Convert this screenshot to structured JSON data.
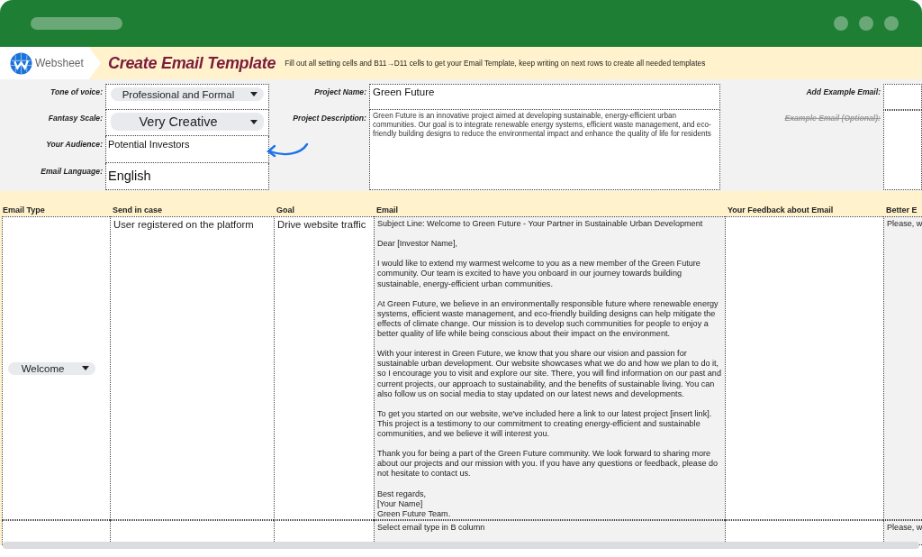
{
  "header": {
    "logo": "Websheet",
    "title": "Create Email Template",
    "instructions": "Fill out all setting cells and B11→D11 cells to get your Email Template, keep writing on next rows to create all needed templates"
  },
  "settings": [
    {
      "label": "Tone of voice:",
      "kind": "dropdown",
      "value": "Professional and Formal"
    },
    {
      "label": "Fantasy Scale:",
      "kind": "dropdown",
      "value": "Very Creative"
    },
    {
      "label": "Your Audience:",
      "kind": "text",
      "value": "Potential Investors"
    },
    {
      "label": "Email Language:",
      "kind": "text",
      "value": "English"
    }
  ],
  "project": [
    {
      "label": "Project Name:",
      "value": "Green Future"
    },
    {
      "label": "Project Description:",
      "value": "Green Future is an innovative project aimed at developing sustainable, energy-efficient urban communities. Our goal is to integrate renewable energy systems, efficient waste management, and eco-friendly building designs to reduce the environmental impact and enhance the quality of life for residents"
    }
  ],
  "example": [
    {
      "label": "Add Example Email:",
      "disabled": false
    },
    {
      "label": "Example Email (Optional):",
      "disabled": true
    }
  ],
  "table": {
    "columns": [
      "Email Type",
      "Send in case",
      "Goal",
      "Email",
      "Your Feedback about Email",
      "Better E"
    ],
    "rows": [
      {
        "email_type": "Welcome",
        "send_in_case": "User registered on the platform",
        "goal": "Drive website traffic",
        "email": "Subject Line: Welcome to Green Future - Your Partner in Sustainable Urban Development\n\nDear [Investor Name],\n\nI would like to extend my warmest welcome to you as a new member of the Green Future community. Our team is excited to have you onboard in our journey towards building sustainable, energy-efficient urban communities.\n\nAt Green Future, we believe in an environmentally responsible future where renewable energy systems, efficient waste management, and eco-friendly building designs can help mitigate the effects of climate change. Our mission is to develop such communities for people to enjoy a better quality of life while being conscious about their impact on the environment.\n\nWith your interest in Green Future, we know that you share our vision and passion for sustainable urban development. Our website showcases what we do and how we plan to do it, so I encourage you to visit and explore our site. There, you will find information on our past and current projects, our approach to sustainability, and the benefits of sustainable living. You can also follow us on social media to stay updated on our latest news and developments.\n\nTo get you started on our website, we've included here a link to our latest project [insert link]. This project is a testimony to our commitment to creating energy-efficient and sustainable communities, and we believe it will interest you.\n\nThank you for being a part of the Green Future community. We look forward to sharing more about our projects and our mission with you. If you have any questions or feedback, please do not hesitate to contact us.\n\nBest regards,\n[Your Name]\nGreen Future Team.",
        "better_email": "Please, w"
      },
      {
        "email": "Select email type in B column",
        "better_email": "Please, w"
      }
    ]
  }
}
